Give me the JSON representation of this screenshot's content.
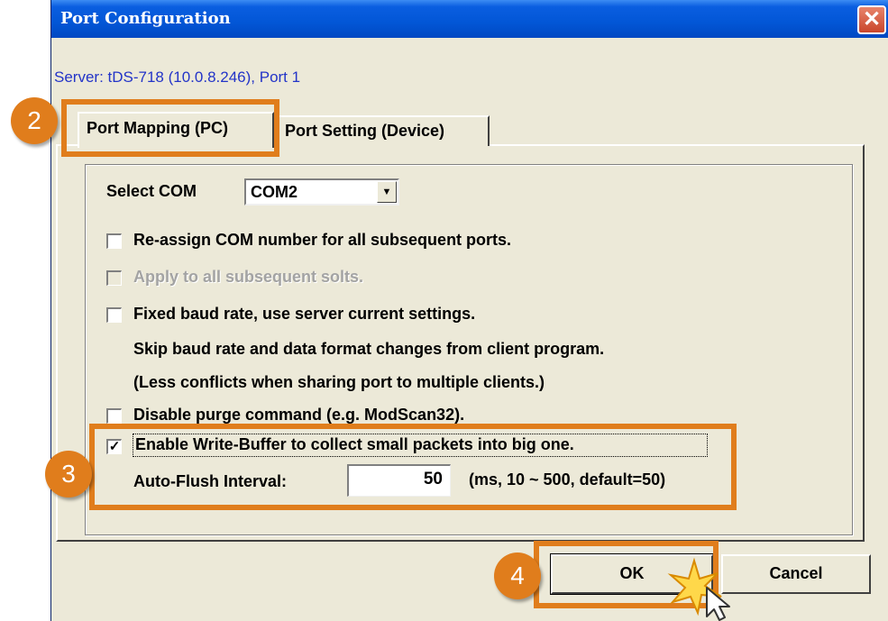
{
  "window": {
    "title": "Port Configuration",
    "close_glyph": "✕"
  },
  "server_label": "Server: tDS-718 (10.0.8.246), Port 1",
  "tabs": [
    {
      "label": "Port Mapping (PC)"
    },
    {
      "label": "Port Setting (Device)"
    }
  ],
  "select_com": {
    "label": "Select COM",
    "value": "COM2",
    "arrow": "▼"
  },
  "options": {
    "reassign": {
      "label": "Re-assign COM number for all subsequent ports.",
      "checked": false
    },
    "apply_all": {
      "label": "Apply to all subsequent solts.",
      "checked": false,
      "disabled": true
    },
    "fixed_baud": {
      "label": "Fixed baud rate, use server current settings.",
      "checked": false
    },
    "fixed_baud_note1": "Skip baud rate and data format changes from client program.",
    "fixed_baud_note2": "(Less conflicts when sharing port to multiple clients.)",
    "disable_purge": {
      "label": "Disable purge command (e.g. ModScan32).",
      "checked": false
    },
    "write_buffer": {
      "label": "Enable Write-Buffer to collect small packets into big one.",
      "checked": true,
      "mark": "✓"
    }
  },
  "auto_flush": {
    "label": "Auto-Flush Interval:",
    "value": "50",
    "hint": "(ms, 10 ~ 500, default=50)"
  },
  "buttons": {
    "ok": "OK",
    "cancel": "Cancel"
  },
  "annotations": {
    "step2": "2",
    "step3": "3",
    "step4": "4",
    "accent_color": "#e07d1c"
  }
}
